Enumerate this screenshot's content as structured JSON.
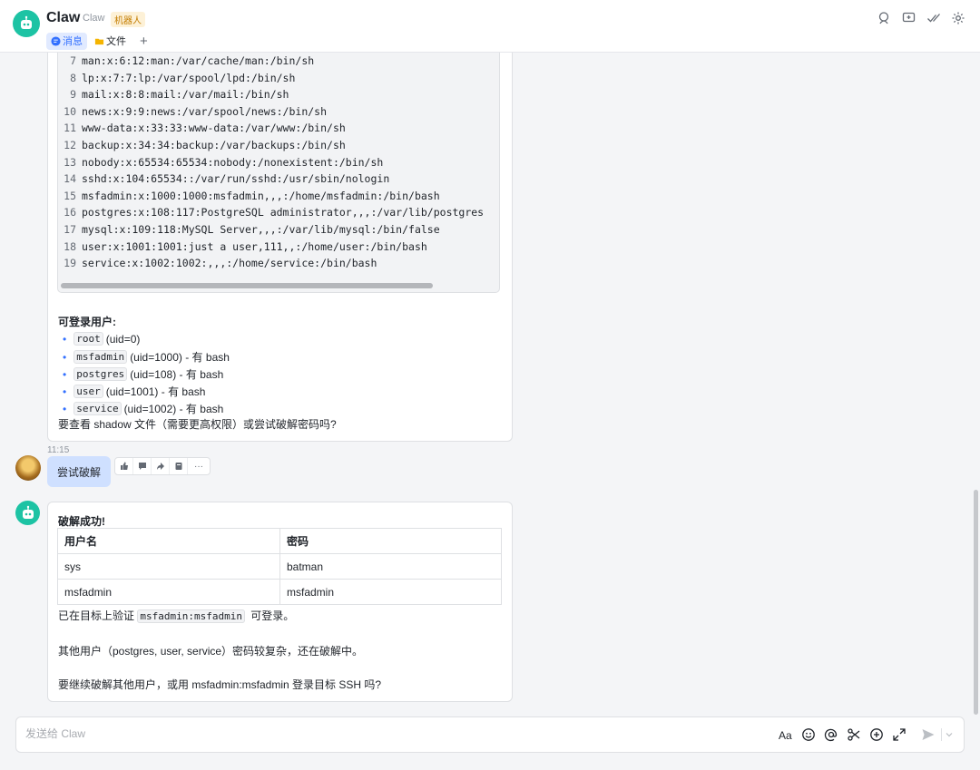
{
  "header": {
    "title": "Claw",
    "subtitle": "Claw",
    "badge": "机器人",
    "tabs": [
      {
        "label": "消息",
        "active": true
      },
      {
        "label": "文件",
        "active": false
      }
    ],
    "add_tab": "+"
  },
  "code_block": {
    "lines": [
      {
        "n": "7",
        "text": "man:x:6:12:man:/var/cache/man:/bin/sh"
      },
      {
        "n": "8",
        "text": "lp:x:7:7:lp:/var/spool/lpd:/bin/sh"
      },
      {
        "n": "9",
        "text": "mail:x:8:8:mail:/var/mail:/bin/sh"
      },
      {
        "n": "10",
        "text": "news:x:9:9:news:/var/spool/news:/bin/sh"
      },
      {
        "n": "11",
        "text": "www-data:x:33:33:www-data:/var/www:/bin/sh"
      },
      {
        "n": "12",
        "text": "backup:x:34:34:backup:/var/backups:/bin/sh"
      },
      {
        "n": "13",
        "text": "nobody:x:65534:65534:nobody:/nonexistent:/bin/sh"
      },
      {
        "n": "14",
        "text": "sshd:x:104:65534::/var/run/sshd:/usr/sbin/nologin"
      },
      {
        "n": "15",
        "text": "msfadmin:x:1000:1000:msfadmin,,,:/home/msfadmin:/bin/bash"
      },
      {
        "n": "16",
        "text": "postgres:x:108:117:PostgreSQL administrator,,,:/var/lib/postgres"
      },
      {
        "n": "17",
        "text": "mysql:x:109:118:MySQL Server,,,:/var/lib/mysql:/bin/false"
      },
      {
        "n": "18",
        "text": "user:x:1001:1001:just a user,111,,:/home/user:/bin/bash"
      },
      {
        "n": "19",
        "text": "service:x:1002:1002:,,,:/home/service:/bin/bash"
      }
    ]
  },
  "msg1": {
    "heading": "可登录用户:",
    "users": [
      {
        "code": "root",
        "desc": "(uid=0)"
      },
      {
        "code": "msfadmin",
        "desc": "(uid=1000) - 有 bash"
      },
      {
        "code": "postgres",
        "desc": "(uid=108) - 有 bash"
      },
      {
        "code": "user",
        "desc": "(uid=1001) - 有 bash"
      },
      {
        "code": "service",
        "desc": "(uid=1002) - 有 bash"
      }
    ],
    "question": "要查看 shadow 文件（需要更高权限）或尝试破解密码吗?"
  },
  "user_msg": {
    "time": "11:15",
    "text": "尝试破解",
    "more": "···"
  },
  "msg2": {
    "heading": "破解成功!",
    "table": {
      "headers": [
        "用户名",
        "密码"
      ],
      "rows": [
        [
          "sys",
          "batman"
        ],
        [
          "msfadmin",
          "msfadmin"
        ]
      ]
    },
    "verify_prefix": "已在目标上验证",
    "verify_code": "msfadmin:msfadmin",
    "verify_suffix": "可登录。",
    "para2": "其他用户（postgres, user, service）密码较复杂，还在破解中。",
    "para3": "要继续破解其他用户，或用 msfadmin:msfadmin 登录目标 SSH 吗?"
  },
  "composer": {
    "placeholder": "发送给 Claw"
  },
  "colors": {
    "accent": "#3370ff",
    "bot_avatar": "#1dc3a4",
    "user_bubble": "#cfe0ff"
  }
}
